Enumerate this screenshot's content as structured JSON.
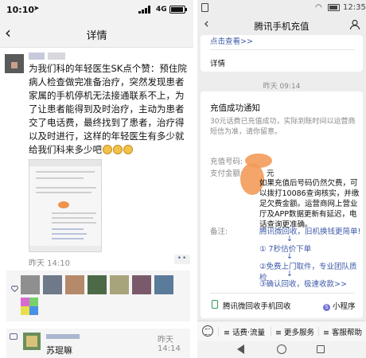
{
  "left": {
    "status_time": "10:10",
    "network": "4G",
    "nav_title": "详情",
    "post_text": "为我们科的年轻医生SK点个赞：预住院病人检查做完准备治疗，突然发现患者家属的手机停机无法接通联系不上，为了让患者能得到及时治疗，主动为患者交了电话费，最终找到了患者，治疗得以及时进行，这样的年轻医生有多少就给我们科来多少吧",
    "post_time": "昨天 14:10",
    "more_dots": "••",
    "comment": {
      "time": "昨天 14:14",
      "text": "苏琨嘛"
    }
  },
  "right": {
    "status_time": "12:35",
    "nav_title": "腾讯手机充值",
    "card1": {
      "link": "点击查看>>",
      "detail": "详情"
    },
    "timestamp": "昨天 09:14",
    "card2": {
      "title": "充值成功通知",
      "desc": "30元话费已充值成功，实际到账时间以运营商短信为准，请你留意。",
      "phone_label": "充值号码:",
      "amount_label": "支付金额:",
      "amount_unit": "元",
      "note": "如果充值后号码仍然欠费，可以拨打10086查询核实，并缴足欠费金额。运营商网上营业厅及APP数据更新有延迟，电话查询更准确。",
      "remark_label": "备注:",
      "promo_1": "腾讯微回收，旧机换钱更简单!",
      "promo_2": "① 7秒估价下单",
      "promo_3": "②免费上门取件，专业团队质检",
      "promo_4": "③确认回收，极速收款>>",
      "down_arrow": "↓",
      "mini_program_label": "腾讯微回收手机回收",
      "mini_program_tag": "小程序"
    },
    "menu": {
      "item1": "≡ 话费·流量",
      "item2": "≡ 更多服务",
      "item3": "≡ 客服帮助"
    }
  }
}
